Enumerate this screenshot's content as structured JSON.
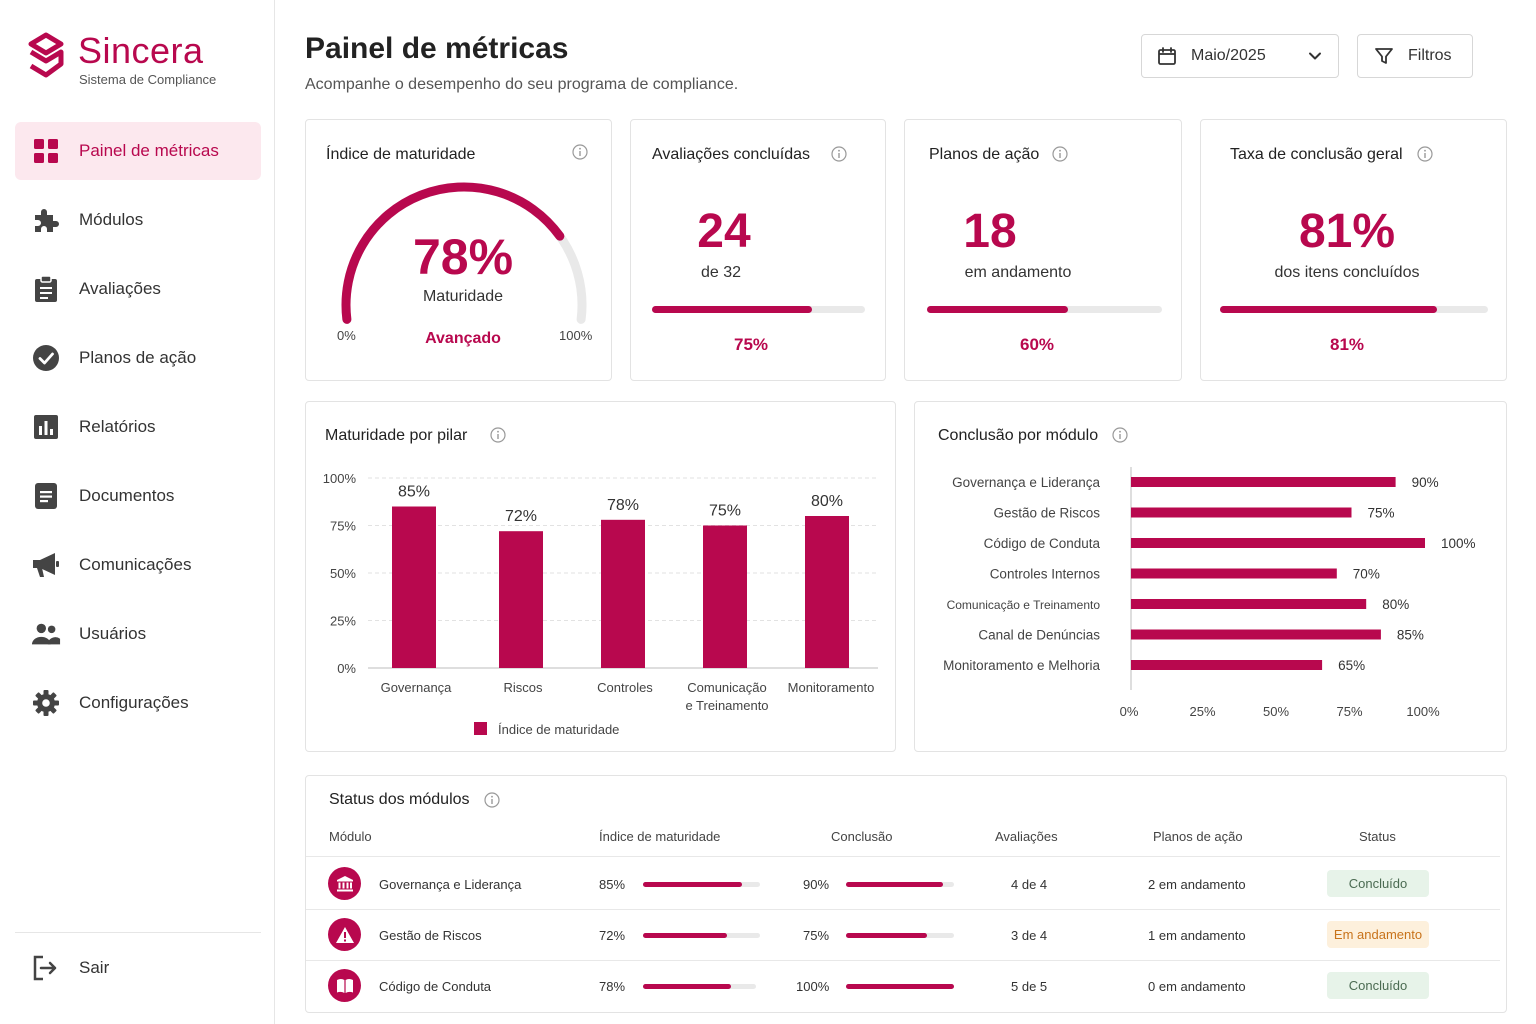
{
  "app": {
    "name": "Sincera",
    "subtitle": "Sistema de Compliance"
  },
  "nav": [
    {
      "label": "Painel de métricas",
      "icon": "dashboard-icon",
      "active": true
    },
    {
      "label": "Módulos",
      "icon": "puzzle-icon"
    },
    {
      "label": "Avaliações",
      "icon": "clipboard-icon"
    },
    {
      "label": "Planos de ação",
      "icon": "check-circle-icon"
    },
    {
      "label": "Relatórios",
      "icon": "bar-chart-icon"
    },
    {
      "label": "Documentos",
      "icon": "document-icon"
    },
    {
      "label": "Comunicações",
      "icon": "megaphone-icon"
    },
    {
      "label": "Usuários",
      "icon": "users-icon"
    },
    {
      "label": "Configurações",
      "icon": "gear-icon"
    }
  ],
  "logout_label": "Sair",
  "header": {
    "title": "Painel de métricas",
    "subtitle": "Acompanhe o desempenho do seu programa de compliance.",
    "date_value": "Maio/2025",
    "filter_label": "Filtros"
  },
  "maturity": {
    "title": "Índice de maturidade",
    "value": "78%",
    "fraction": 0.78,
    "label": "Maturidade",
    "level": "Avançado",
    "min_label": "0%",
    "max_label": "100%"
  },
  "kpis": [
    {
      "title": "Avaliações concluídas",
      "value": "24",
      "sub": "de 32",
      "pct": "75%",
      "fraction": 0.75
    },
    {
      "title": "Planos de ação",
      "value": "18",
      "sub": "em andamento",
      "pct": "60%",
      "fraction": 0.6
    },
    {
      "title": "Taxa de conclusão geral",
      "value": "81%",
      "sub": "dos itens concluídos",
      "pct": "81%",
      "fraction": 0.81
    }
  ],
  "chart_data": [
    {
      "type": "bar",
      "title": "Maturidade por pilar",
      "categories": [
        "Governança",
        "Riscos",
        "Controles",
        "Comunicação e Treinamento",
        "Monitoramento"
      ],
      "category_lines": [
        [
          "Governança"
        ],
        [
          "Riscos"
        ],
        [
          "Controles"
        ],
        [
          "Comunicação",
          "e Treinamento"
        ],
        [
          "Monitoramento"
        ]
      ],
      "series": [
        {
          "name": "Índice de maturidade",
          "values": [
            85,
            72,
            78,
            75,
            80
          ]
        }
      ],
      "data_labels": [
        "85%",
        "72%",
        "78%",
        "75%",
        "80%"
      ],
      "ylim": [
        0,
        100
      ],
      "yticks": [
        "0%",
        "25%",
        "50%",
        "75%",
        "100%"
      ],
      "grid": true,
      "legend": "bottom"
    },
    {
      "type": "bar",
      "orientation": "horizontal",
      "title": "Conclusão por módulo",
      "categories": [
        "Governança e Liderança",
        "Gestão de Riscos",
        "Código de Conduta",
        "Controles Internos",
        "Comunicação e Treinamento",
        "Canal de Denúncias",
        "Monitoramento e Melhoria"
      ],
      "values": [
        90,
        75,
        100,
        70,
        80,
        85,
        65
      ],
      "data_labels": [
        "90%",
        "75%",
        "100%",
        "70%",
        "80%",
        "85%",
        "65%"
      ],
      "xlim": [
        0,
        100
      ],
      "xticks": [
        "0%",
        "25%",
        "50%",
        "75%",
        "100%"
      ]
    }
  ],
  "status_table": {
    "title": "Status dos módulos",
    "headers": [
      "Módulo",
      "Índice de maturidade",
      "Conclusão",
      "Avaliações",
      "Planos de ação",
      "Status"
    ],
    "rows": [
      {
        "icon": "bank-icon",
        "module": "Governança e Liderança",
        "maturity": "85%",
        "maturity_fraction": 0.85,
        "completion": "90%",
        "completion_fraction": 0.9,
        "assessments": "4 de 4",
        "plans": "2 em andamento",
        "status": "Concluído",
        "status_kind": "done"
      },
      {
        "icon": "warning-icon",
        "module": "Gestão de Riscos",
        "maturity": "72%",
        "maturity_fraction": 0.72,
        "completion": "75%",
        "completion_fraction": 0.75,
        "assessments": "3 de 4",
        "plans": "1 em andamento",
        "status": "Em andamento",
        "status_kind": "prog"
      },
      {
        "icon": "book-icon",
        "module": "Código de Conduta",
        "maturity": "78%",
        "maturity_fraction": 0.78,
        "completion": "100%",
        "completion_fraction": 1.0,
        "assessments": "5 de 5",
        "plans": "0 em andamento",
        "status": "Concluído",
        "status_kind": "done"
      }
    ]
  },
  "colors": {
    "accent": "#b8084e",
    "track": "#e9e9e9"
  }
}
